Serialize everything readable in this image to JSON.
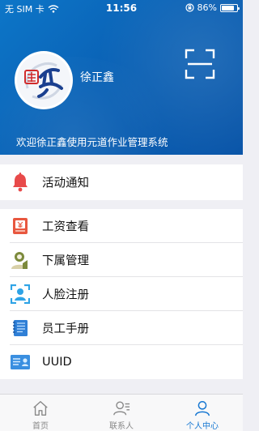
{
  "status_bar": {
    "carrier": "无 SIM 卡",
    "time": "11:56",
    "battery": "86%",
    "battery_level": 0.86
  },
  "header": {
    "username": "徐正鑫",
    "welcome": "欢迎徐正鑫使用元道作业管理系统",
    "avatar_icon": "yuandao-logo-icon",
    "scan_icon": "scan-icon"
  },
  "menu_groups": [
    [
      {
        "label": "活动通知",
        "icon": "bell-icon",
        "color": "#e84a4a"
      }
    ],
    [
      {
        "label": "工资查看",
        "icon": "salary-icon",
        "color": "#e8573f"
      },
      {
        "label": "下属管理",
        "icon": "person-icon",
        "color": "#7c8a3c"
      },
      {
        "label": "人脸注册",
        "icon": "face-scan-icon",
        "color": "#2ea3e6"
      },
      {
        "label": "员工手册",
        "icon": "handbook-icon",
        "color": "#2f7fd6"
      },
      {
        "label": "UUID",
        "icon": "id-card-icon",
        "color": "#3a8fe0"
      }
    ]
  ],
  "tabs": [
    {
      "label": "首页",
      "icon": "home-icon",
      "active": false
    },
    {
      "label": "联系人",
      "icon": "contacts-icon",
      "active": false
    },
    {
      "label": "个人中心",
      "icon": "profile-icon",
      "active": true
    }
  ],
  "colors": {
    "header_blue": "#0a62b6",
    "active_tab": "#1677d2",
    "inactive_tab": "#888888"
  }
}
